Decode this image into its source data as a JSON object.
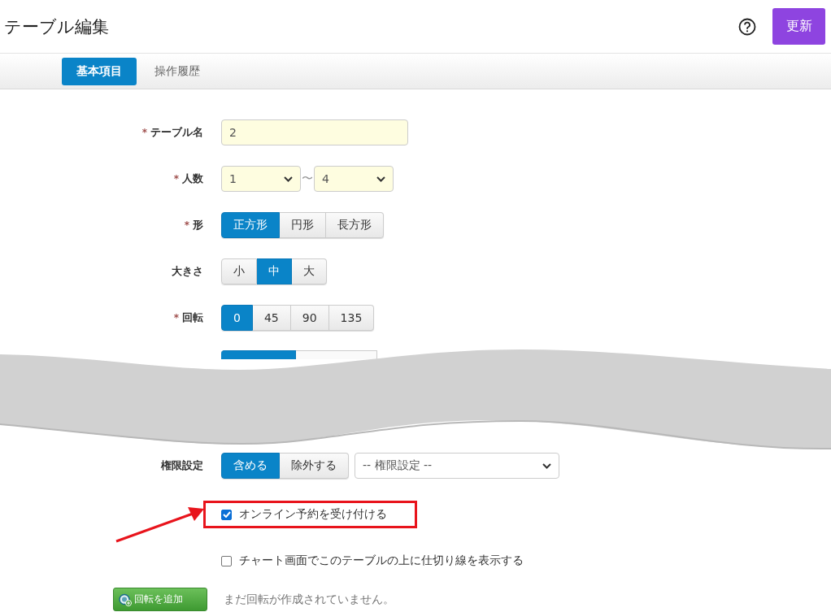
{
  "header": {
    "title": "テーブル編集",
    "update_button": "更新"
  },
  "tabs": [
    {
      "label": "基本項目",
      "selected": true
    },
    {
      "label": "操作履歴",
      "selected": false
    }
  ],
  "form": {
    "rows": [
      {
        "kind": "text",
        "marker": "*",
        "label": "テーブル名",
        "value": "2"
      },
      {
        "kind": "range",
        "marker": "*",
        "label": "人数",
        "from": "1",
        "separator": "〜",
        "to": "4"
      },
      {
        "kind": "segments",
        "marker": "*",
        "label": "形",
        "options": [
          {
            "label": "正方形",
            "selected": true
          },
          {
            "label": "円形",
            "selected": false
          },
          {
            "label": "長方形",
            "selected": false
          }
        ]
      },
      {
        "kind": "segments",
        "label": "大きさ",
        "options": [
          {
            "label": "小",
            "selected": false
          },
          {
            "label": "中",
            "selected": true
          },
          {
            "label": "大",
            "selected": false
          }
        ]
      },
      {
        "kind": "segments",
        "marker": "*",
        "label": "回転",
        "options": [
          {
            "label": "0",
            "selected": true
          },
          {
            "label": "45",
            "selected": false
          },
          {
            "label": "90",
            "selected": false
          },
          {
            "label": "135",
            "selected": false
          }
        ]
      },
      {
        "kind": "covered",
        "options": [
          {
            "selected": true
          },
          {
            "selected": false
          }
        ]
      },
      {
        "kind": "segments_select",
        "label": "権限設定",
        "options": [
          {
            "label": "含める",
            "selected": true
          },
          {
            "label": "除外する",
            "selected": false
          }
        ],
        "select": "-- 権限設定 --"
      },
      {
        "kind": "checkbox",
        "label": "オンライン予約を受け付ける",
        "checked": true,
        "highlighted": true
      },
      {
        "kind": "checkbox",
        "label": "チャート画面でこのテーブルの上に仕切り線を表示する",
        "checked": false
      }
    ]
  },
  "footer": {
    "add_button": "回転を追加",
    "note": "まだ回転が作成されていません。"
  }
}
